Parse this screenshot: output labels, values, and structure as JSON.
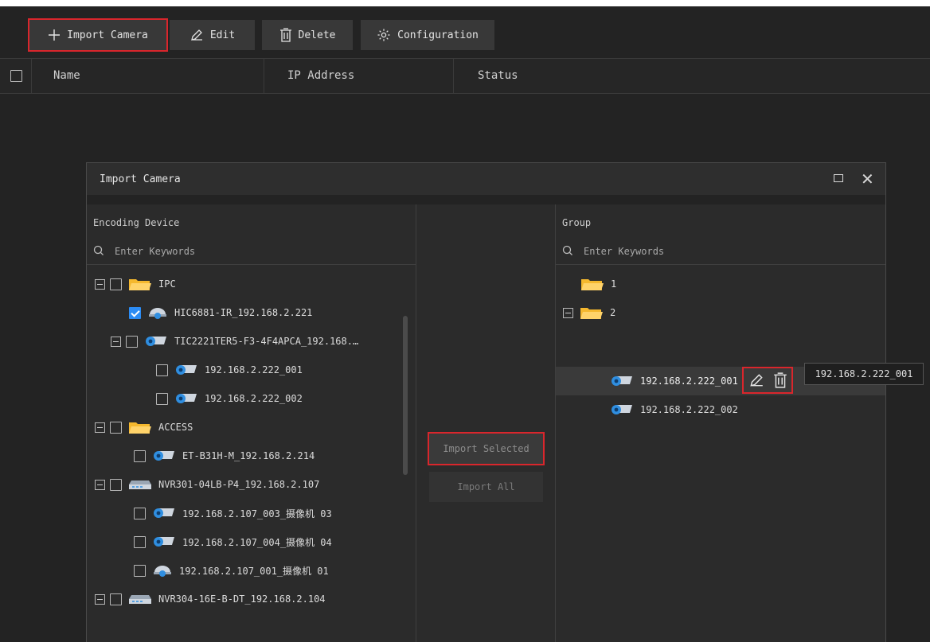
{
  "toolbar": {
    "import_label": "Import Camera",
    "edit_label": "Edit",
    "delete_label": "Delete",
    "config_label": "Configuration"
  },
  "table": {
    "columns": [
      "Name",
      "IP Address",
      "Status"
    ]
  },
  "dialog": {
    "title": "Import Camera",
    "left": {
      "title": "Encoding Device",
      "search_placeholder": "Enter Keywords",
      "items": [
        "IPC",
        "HIC6881-IR_192.168.2.221",
        "TIC2221TER5-F3-4F4APCA_192.168.…",
        "192.168.2.222_001",
        "192.168.2.222_002",
        "ACCESS",
        "ET-B31H-M_192.168.2.214",
        "NVR301-04LB-P4_192.168.2.107",
        "192.168.2.107_003_摄像机 03",
        "192.168.2.107_004_摄像机 04",
        "192.168.2.107_001_摄像机 01",
        "NVR304-16E-B-DT_192.168.2.104"
      ]
    },
    "middle": {
      "import_selected": "Import Selected",
      "import_all": "Import All"
    },
    "right": {
      "title": "Group",
      "search_placeholder": "Enter Keywords",
      "items": [
        "1",
        "2",
        "192.168.2.222_001",
        "192.168.2.222_002"
      ]
    },
    "tooltip": "192.168.2.222_001"
  },
  "colors": {
    "accent_red": "#d9262c",
    "checkbox_blue": "#2c8cf4",
    "folder_yellow": "#f5b82e",
    "camera_blue": "#2f8ee0"
  }
}
